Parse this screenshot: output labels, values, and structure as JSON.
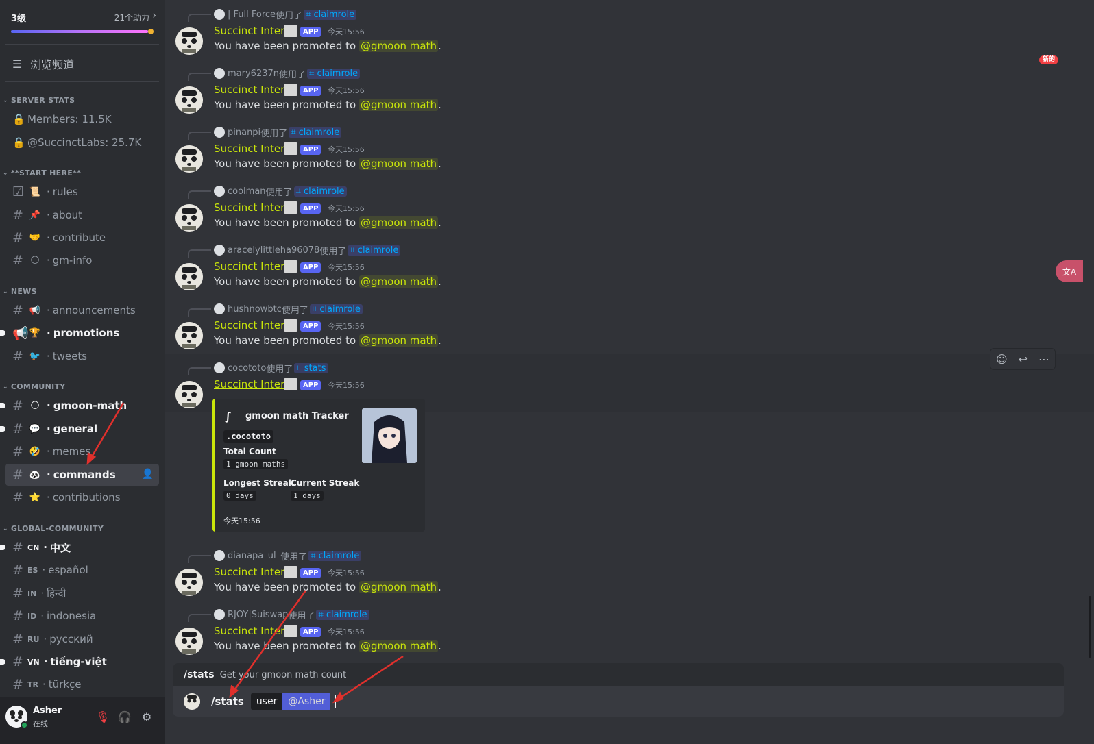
{
  "sidebar": {
    "boost": {
      "level": "3级",
      "count": "21个助力",
      "progress": 0.97
    },
    "browse_label": "浏览频道",
    "categories": {
      "server_stats": "SERVER STATS",
      "start_here": "**START HERE**",
      "news": "NEWS",
      "community": "COMMUNITY",
      "global_community": "GLOBAL-COMMUNITY"
    },
    "stats": [
      "Members: 11.5K",
      "@SuccinctLabs: 25.7K"
    ],
    "start_here": [
      {
        "label": "rules",
        "emoji": "📜"
      },
      {
        "label": "about",
        "emoji": "📌"
      },
      {
        "label": "contribute",
        "emoji": "🤝"
      },
      {
        "label": "gm-info",
        "emoji": "🌕"
      }
    ],
    "news": [
      {
        "label": "announcements",
        "emoji": "📢"
      },
      {
        "label": "promotions",
        "emoji": "🏆"
      },
      {
        "label": "tweets",
        "emoji": "🐦"
      }
    ],
    "community": [
      {
        "label": "gmoon-math",
        "emoji": "🌕"
      },
      {
        "label": "general",
        "emoji": "💬"
      },
      {
        "label": "memes",
        "emoji": "🤣"
      },
      {
        "label": "commands",
        "emoji": "🐼"
      },
      {
        "label": "contributions",
        "emoji": "⭐"
      }
    ],
    "global": [
      {
        "flag": "CN",
        "label": "中文"
      },
      {
        "flag": "ES",
        "label": "español"
      },
      {
        "flag": "IN",
        "label": "हिन्दी"
      },
      {
        "flag": "ID",
        "label": "indonesia"
      },
      {
        "flag": "RU",
        "label": "русский"
      },
      {
        "flag": "VN",
        "label": "tiếng-việt"
      },
      {
        "flag": "TR",
        "label": "türkçe"
      }
    ],
    "separator": "·"
  },
  "user": {
    "name": "Asher",
    "status": "在线"
  },
  "messages": {
    "bot_name": "Succinct Intern",
    "app_badge": "APP",
    "timestamp": "今天15:56",
    "used": "使用了",
    "promoted_text": "You have been promoted to",
    "role": "@gmoon math",
    "period": ".",
    "list": [
      {
        "user": "| Full Force",
        "cmd": "claimrole"
      },
      {
        "user": "mary6237n",
        "cmd": "claimrole"
      },
      {
        "user": "pinanpi",
        "cmd": "claimrole"
      },
      {
        "user": "coolman",
        "cmd": "claimrole"
      },
      {
        "user": "aracelylittleha96078",
        "cmd": "claimrole"
      },
      {
        "user": "hushnowbtc",
        "cmd": "claimrole"
      },
      {
        "user": "cocototo",
        "cmd": "stats"
      },
      {
        "user": "dianapa_ul_",
        "cmd": "claimrole"
      },
      {
        "user": "RJOY|Suiswap",
        "cmd": "claimrole"
      }
    ],
    "new_tag": "新的"
  },
  "embed": {
    "title": "gmoon math Tracker",
    "username": ".cocototo",
    "total_label": "Total Count",
    "total_value": "1 gmoon maths",
    "longest_label": "Longest Streak",
    "longest_value": "0 days",
    "current_label": "Current Streak",
    "current_value": "1 days",
    "time": "今天15:56"
  },
  "composer": {
    "hint_cmd": "/stats",
    "hint_desc": "Get your gmoon math count",
    "cmd": "/stats",
    "option_name": "user",
    "option_value": "@Asher"
  },
  "translate_label": "文A",
  "colors": {
    "accent": "#c9e50a",
    "blurple": "#5865f2",
    "mention_link": "#00a8fc",
    "new_line": "#f23f43",
    "annotation": "#e0302c"
  }
}
